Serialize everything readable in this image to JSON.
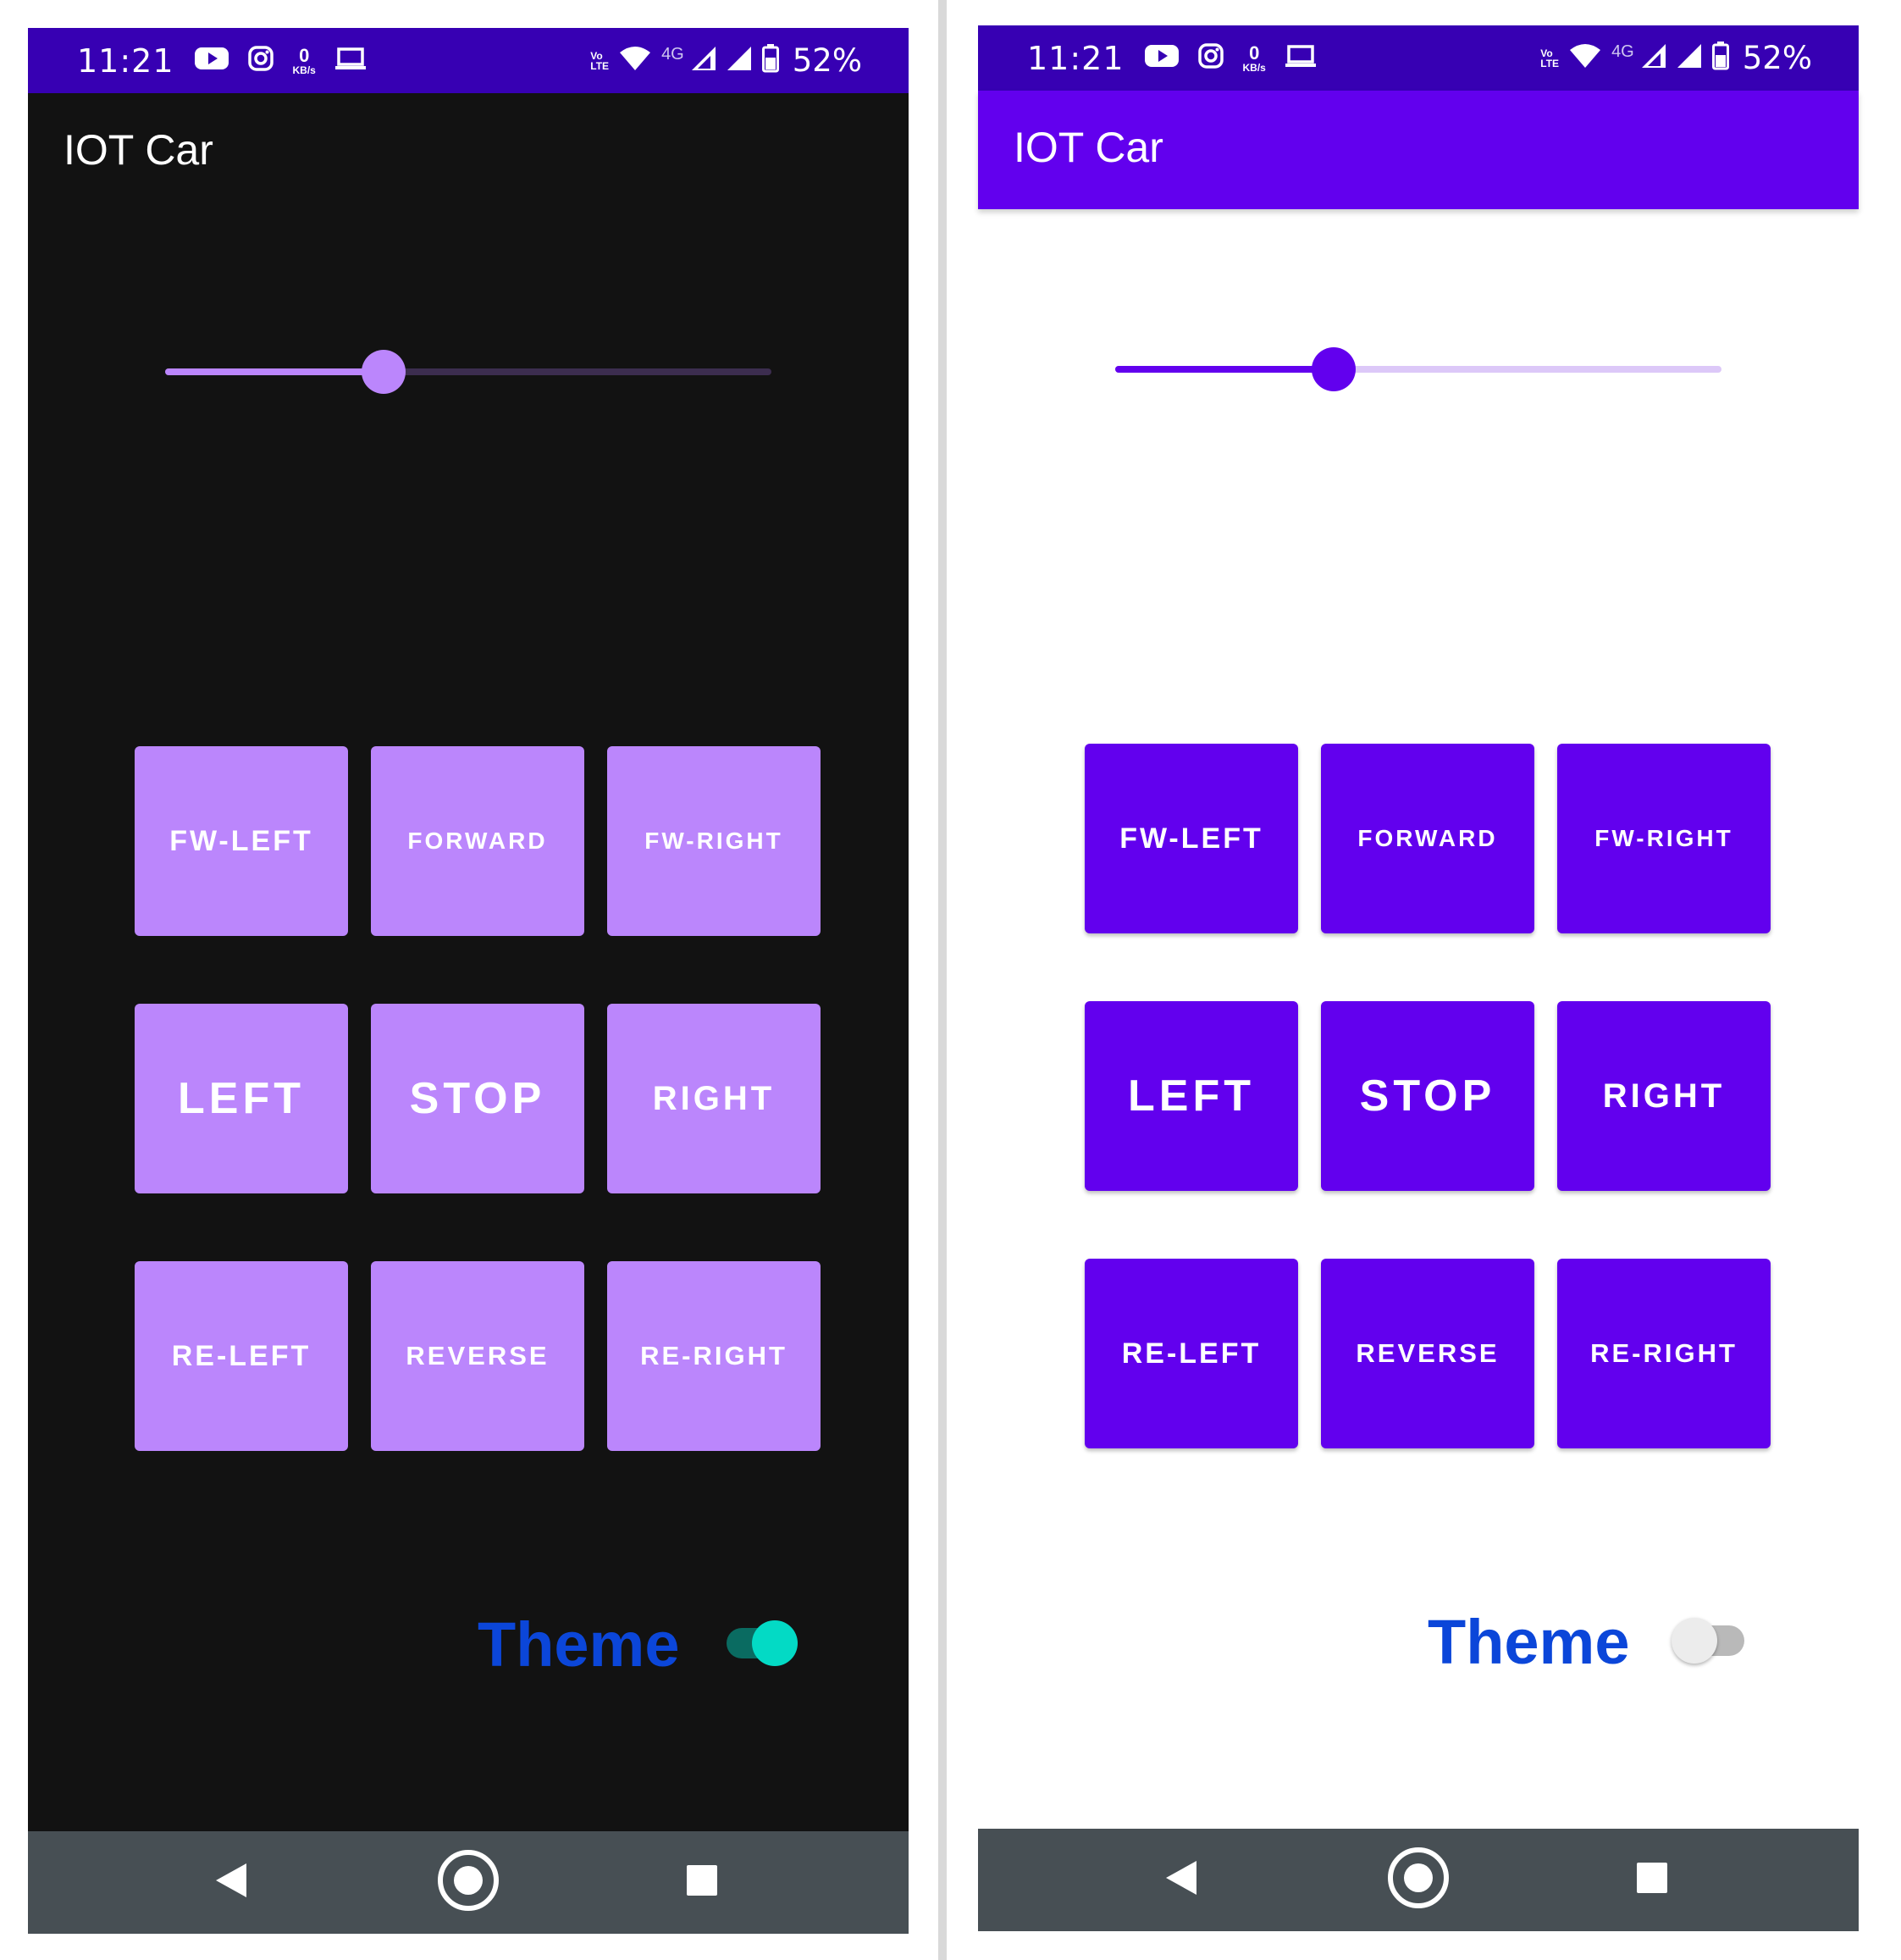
{
  "screens": {
    "dark": {
      "status": {
        "time": "11:21",
        "data_speed": "0",
        "data_unit": "KB/s",
        "volte_top": "Vo",
        "volte_bottom": "LTE",
        "network": "4G",
        "battery": "52%"
      },
      "app_title": "IOT Car",
      "slider_value": 0.36,
      "buttons": [
        {
          "label": "FW-LEFT"
        },
        {
          "label": "FORWARD"
        },
        {
          "label": "FW-RIGHT"
        },
        {
          "label": "LEFT"
        },
        {
          "label": "STOP"
        },
        {
          "label": "RIGHT"
        },
        {
          "label": "RE-LEFT"
        },
        {
          "label": "REVERSE"
        },
        {
          "label": "RE-RIGHT"
        }
      ],
      "theme_label": "Theme",
      "theme_switch_on": true
    },
    "light": {
      "status": {
        "time": "11:21",
        "data_speed": "0",
        "data_unit": "KB/s",
        "volte_top": "Vo",
        "volte_bottom": "LTE",
        "network": "4G",
        "battery": "52%"
      },
      "app_title": "IOT Car",
      "slider_value": 0.36,
      "buttons": [
        {
          "label": "FW-LEFT"
        },
        {
          "label": "FORWARD"
        },
        {
          "label": "FW-RIGHT"
        },
        {
          "label": "LEFT"
        },
        {
          "label": "STOP"
        },
        {
          "label": "RIGHT"
        },
        {
          "label": "RE-LEFT"
        },
        {
          "label": "REVERSE"
        },
        {
          "label": "RE-RIGHT"
        }
      ],
      "theme_label": "Theme",
      "theme_switch_on": false
    }
  },
  "icons": {
    "status_left": [
      "youtube-icon",
      "instagram-icon",
      "laptop-icon"
    ],
    "status_right": [
      "wifi-icon",
      "signal-icon",
      "battery-icon"
    ],
    "nav": [
      "back-icon",
      "home-icon",
      "recents-icon"
    ]
  },
  "colors": {
    "status_bar": "#3700b3",
    "dark_background": "#121212",
    "dark_button": "#bb86fc",
    "light_appbar": "#6200ee",
    "light_button": "#6200ee",
    "theme_label": "#0b46d9",
    "switch_on": "#03dac5",
    "nav_bar": "#474f54"
  }
}
